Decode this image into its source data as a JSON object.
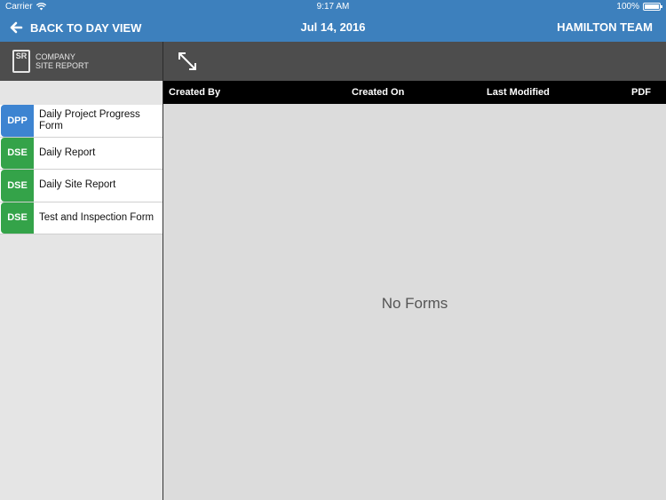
{
  "status_bar": {
    "carrier": "Carrier",
    "time": "9:17 AM",
    "battery": "100%"
  },
  "nav": {
    "back_label": "BACK TO DAY VIEW",
    "date": "Jul 14, 2016",
    "team": "HAMILTON TEAM"
  },
  "logo": {
    "mark": "SR",
    "line1": "COMPANY",
    "line2": "SITE REPORT"
  },
  "forms": [
    {
      "badge": "DPP",
      "label": "Daily Project Progress Form",
      "color": "#3d84d1"
    },
    {
      "badge": "DSE",
      "label": "Daily Report",
      "color": "#34a349"
    },
    {
      "badge": "DSE",
      "label": "Daily Site Report",
      "color": "#34a349"
    },
    {
      "badge": "DSE",
      "label": "Test and Inspection Form",
      "color": "#34a349"
    }
  ],
  "table": {
    "columns": [
      "Created By",
      "Created On",
      "Last Modified",
      "PDF"
    ]
  },
  "empty_message": "No Forms",
  "colors": {
    "accent": "#3d80bd",
    "toolbar": "#4d4d4d",
    "header": "#000000"
  }
}
